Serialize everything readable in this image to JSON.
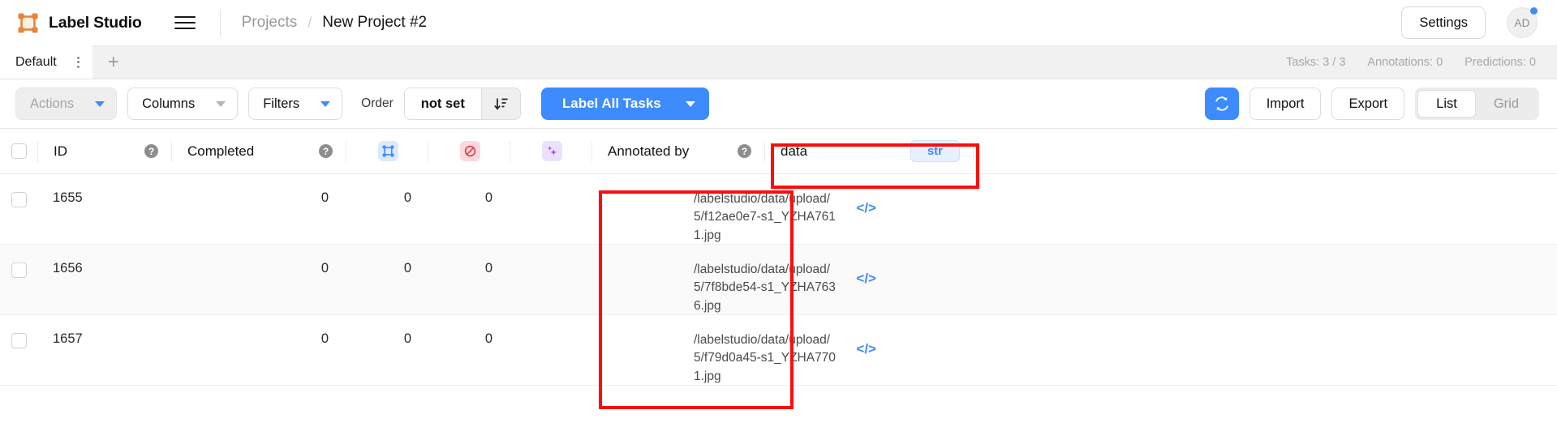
{
  "app": {
    "brand_name": "Label Studio",
    "logo_icon": "label-studio-logo-icon",
    "menu_icon": "hamburger-menu-icon"
  },
  "breadcrumb": {
    "parent": "Projects",
    "separator": "/",
    "current": "New Project #2"
  },
  "header": {
    "settings_label": "Settings",
    "avatar_initials": "AD",
    "avatar_badge": "notification-dot"
  },
  "tabs": {
    "items": [
      {
        "label": "Default",
        "active": true,
        "menu_icon": "tab-options-icon"
      }
    ],
    "add_label": "+",
    "stats": {
      "tasks": "Tasks: 3 / 3",
      "annotations": "Annotations: 0",
      "predictions": "Predictions: 0"
    }
  },
  "toolbar": {
    "actions_label": "Actions",
    "actions_disabled": true,
    "columns_label": "Columns",
    "filters_label": "Filters",
    "order_label": "Order",
    "order_value": "not set",
    "order_sort_icon": "sort-descending-icon",
    "label_all_tasks_label": "Label All Tasks",
    "refresh_icon": "refresh-icon",
    "import_label": "Import",
    "export_label": "Export",
    "view_list_label": "List",
    "view_grid_label": "Grid",
    "view_active": "List"
  },
  "table": {
    "select_all_checkbox": "",
    "columns": [
      {
        "key": "id",
        "label": "ID",
        "help": "?"
      },
      {
        "key": "completed",
        "label": "Completed",
        "help": "?"
      },
      {
        "key": "annotations_icon",
        "label": "",
        "icon": "annotations-icon"
      },
      {
        "key": "cancelled_icon",
        "label": "",
        "icon": "cancelled-icon"
      },
      {
        "key": "predictions_icon",
        "label": "",
        "icon": "predictions-sparkle-icon"
      },
      {
        "key": "annotated_by",
        "label": "Annotated by",
        "help": "?"
      },
      {
        "key": "data",
        "label": "data",
        "badge": "str"
      }
    ],
    "rows": [
      {
        "id": "1655",
        "completed": "0",
        "annotations": "0",
        "cancelled": "0",
        "annotated_by": "",
        "data_path": "/labelstudio/data/upload/5/f12ae0e7-s1_YZHA7611.jpg",
        "code_icon": "</>"
      },
      {
        "id": "1656",
        "completed": "0",
        "annotations": "0",
        "cancelled": "0",
        "annotated_by": "",
        "data_path": "/labelstudio/data/upload/5/7f8bde54-s1_YZHA7636.jpg",
        "code_icon": "</>"
      },
      {
        "id": "1657",
        "completed": "0",
        "annotations": "0",
        "cancelled": "0",
        "annotated_by": "",
        "data_path": "/labelstudio/data/upload/5/f79d0a45-s1_YZHA7701.jpg",
        "code_icon": "</>"
      }
    ]
  },
  "annotations": {
    "highlight_color": "#fb0d0d",
    "boxes": [
      {
        "name": "data-column-header-highlight"
      },
      {
        "name": "annotated-by-cells-highlight"
      }
    ]
  },
  "colors": {
    "accent_blue": "#3d8bfd",
    "brand_orange": "#e8833a",
    "badge_blue": "#3d8bfd"
  }
}
